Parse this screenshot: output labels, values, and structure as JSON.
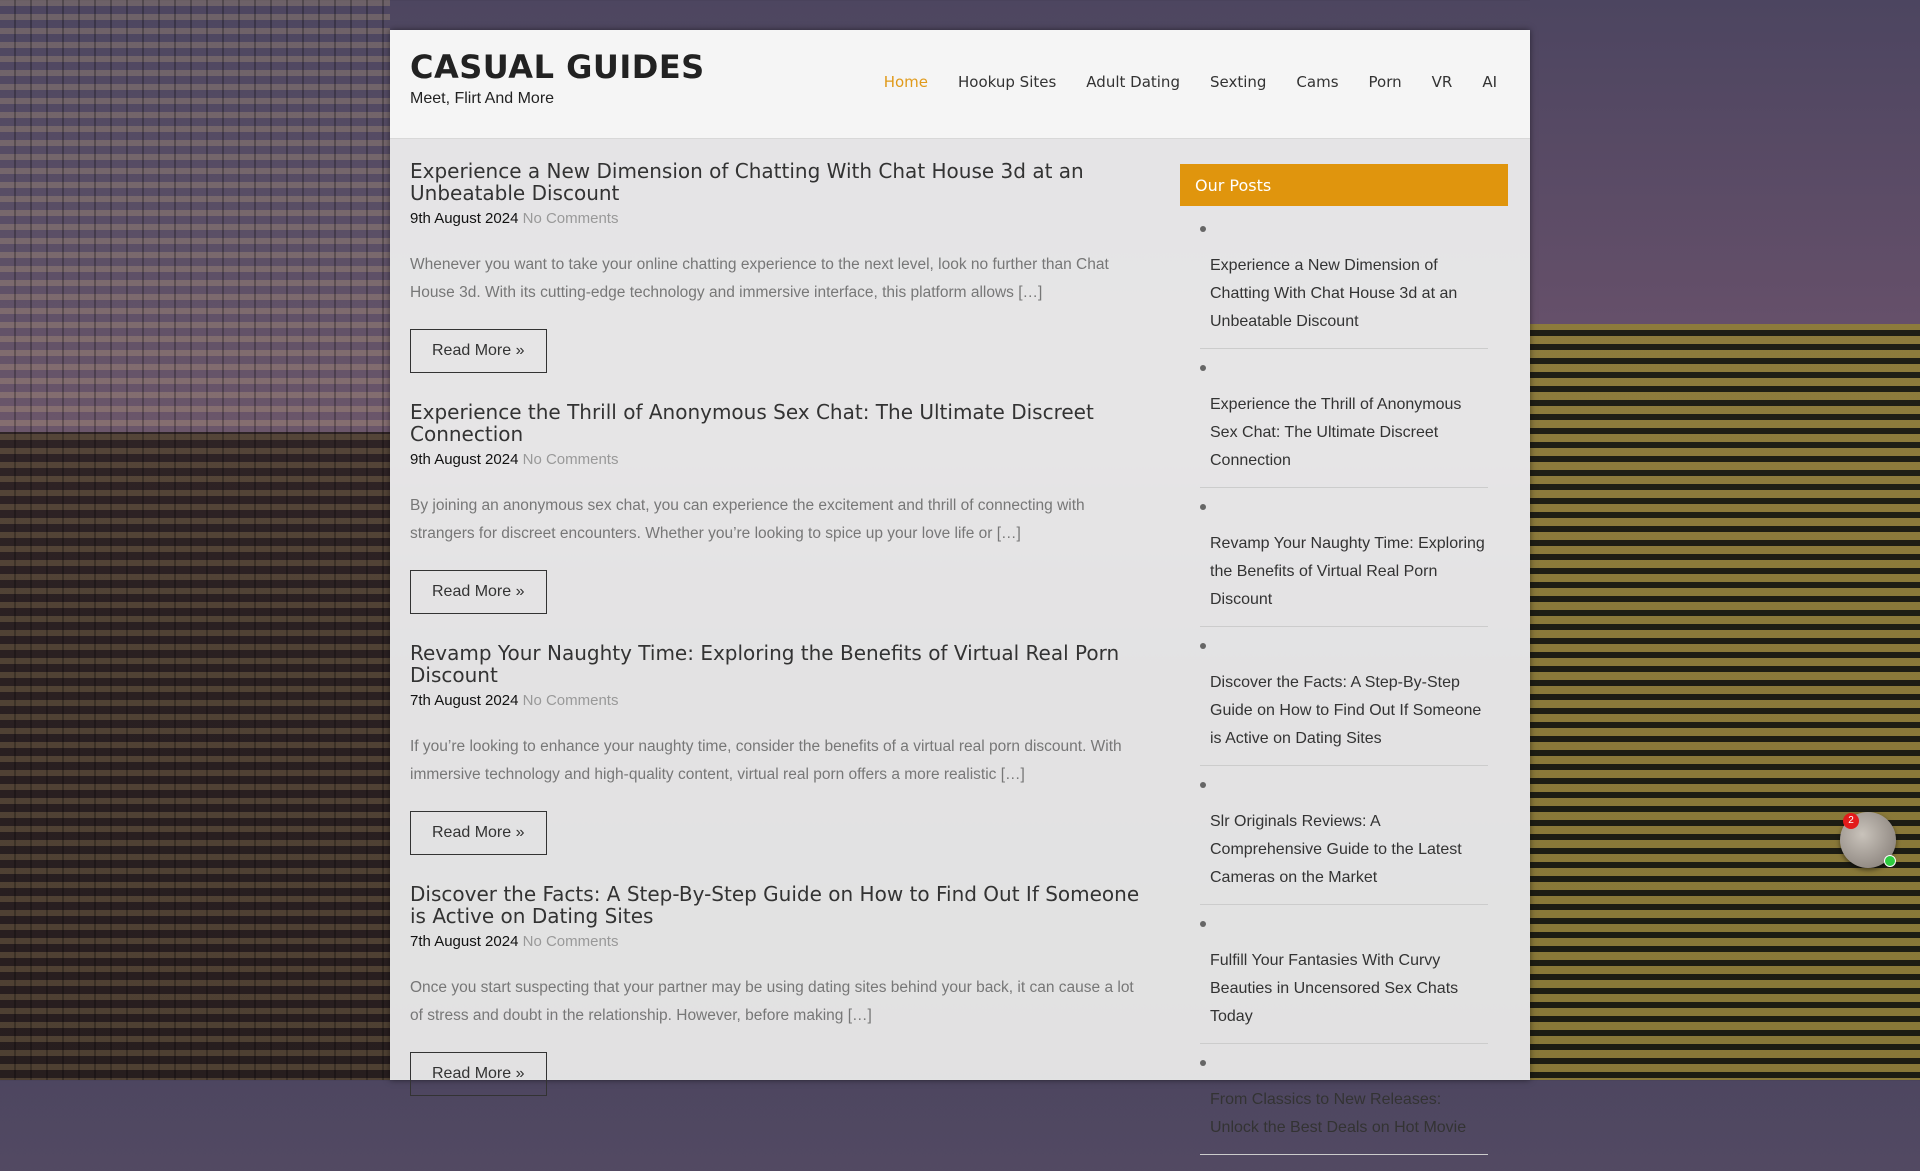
{
  "site": {
    "title": "CASUAL GUIDES",
    "tagline": "Meet, Flirt And More"
  },
  "nav": {
    "items": [
      {
        "label": "Home",
        "active": true
      },
      {
        "label": "Hookup Sites"
      },
      {
        "label": "Adult Dating"
      },
      {
        "label": "Sexting"
      },
      {
        "label": "Cams"
      },
      {
        "label": "Porn"
      },
      {
        "label": "VR"
      },
      {
        "label": "AI"
      }
    ]
  },
  "posts": [
    {
      "title": "Experience a New Dimension of Chatting With Chat House 3d at an Unbeatable Discount",
      "date": "9th August 2024",
      "comments": "No Comments",
      "excerpt": "Whenever you want to take your online chatting experience to the next level, look no further than Chat House 3d. With its cutting-edge technology and immersive interface, this platform allows […]",
      "read_more": "Read More »"
    },
    {
      "title": "Experience the Thrill of Anonymous Sex Chat: The Ultimate Discreet Connection",
      "date": "9th August 2024",
      "comments": "No Comments",
      "excerpt": "By joining an anonymous sex chat, you can experience the excitement and thrill of connecting with strangers for discreet encounters. Whether you’re looking to spice up your love life or […]",
      "read_more": "Read More »"
    },
    {
      "title": "Revamp Your Naughty Time: Exploring the Benefits of Virtual Real Porn Discount",
      "date": "7th August 2024",
      "comments": "No Comments",
      "excerpt": "If you’re looking to enhance your naughty time, consider the benefits of a virtual real porn discount. With immersive technology and high-quality content, virtual real porn offers a more realistic […]",
      "read_more": "Read More »"
    },
    {
      "title": "Discover the Facts: A Step-By-Step Guide on How to Find Out If Someone is Active on Dating Sites",
      "date": "7th August 2024",
      "comments": "No Comments",
      "excerpt": "Once you start suspecting that your partner may be using dating sites behind your back, it can cause a lot of stress and doubt in the relationship. However, before making […]",
      "read_more": "Read More »"
    }
  ],
  "sidebar": {
    "widget_title": "Our Posts",
    "items": [
      "Experience a New Dimension of Chatting With Chat House 3d at an Unbeatable Discount",
      "Experience the Thrill of Anonymous Sex Chat: The Ultimate Discreet Connection",
      "Revamp Your Naughty Time: Exploring the Benefits of Virtual Real Porn Discount",
      "Discover the Facts: A Step-By-Step Guide on How to Find Out If Someone is Active on Dating Sites",
      "Slr Originals Reviews: A Comprehensive Guide to the Latest Cameras on the Market",
      "Fulfill Your Fantasies With Curvy Beauties in Uncensored Sex Chats Today",
      "From Classics to New Releases: Unlock the Best Deals on Hot Movie"
    ]
  },
  "chat_widget": {
    "badge_count": "2",
    "icon": "chat-avatar-icon"
  },
  "colors": {
    "accent": "#e0950d",
    "nav_active": "#e09a1a"
  }
}
